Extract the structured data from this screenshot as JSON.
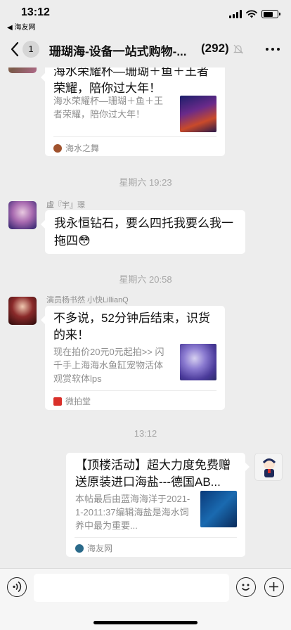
{
  "status_bar": {
    "time": "13:12",
    "back_app": "◀ 海友网",
    "battery_level": 0.7
  },
  "nav": {
    "title": "珊瑚海-设备一站式购物-...",
    "count": "(292)",
    "unread": "1"
  },
  "messages": {
    "card1": {
      "title": "海水荣耀杯—珊瑚＋鱼＋王者荣耀，陪你过大年！",
      "desc": "海水荣耀杯—珊瑚＋鱼＋王者荣耀，陪你过大年！",
      "source": "海水之舞"
    },
    "time1": "星期六 19:23",
    "msg2": {
      "sender": "盧『宇』璟",
      "text": "我永恒钻石，要么四托我要么我一拖四😳"
    },
    "time2": "星期六 20:58",
    "card3": {
      "sender": "演员杨书然 小快LillianQ",
      "title": "不多说，52分钟后结束，识货的来！",
      "desc": "现在拍价20元0元起拍>> 闪千手上海海水鱼缸宠物活体观赏软体lps",
      "source": "微拍堂"
    },
    "time3": "13:12",
    "card4": {
      "title": "【顶楼活动】超大力度免费赠送原装进口海盐---德国AB...",
      "desc": "本帖最后由蓝海海洋于2021-1-2011:37编辑海盐是海水饲养中最为重要...",
      "source": "海友网"
    }
  },
  "input": {
    "placeholder": ""
  },
  "colors": {
    "background": "#ededed",
    "bubble": "#ffffff",
    "meta_text": "#8e8e8e",
    "source_weipaitang": "#d9302a"
  },
  "icons": [
    "back-arrow-icon",
    "mute-bell-icon",
    "more-icon",
    "voice-icon",
    "emoji-icon",
    "plus-icon",
    "wifi-icon",
    "signal-icon",
    "battery-icon"
  ]
}
